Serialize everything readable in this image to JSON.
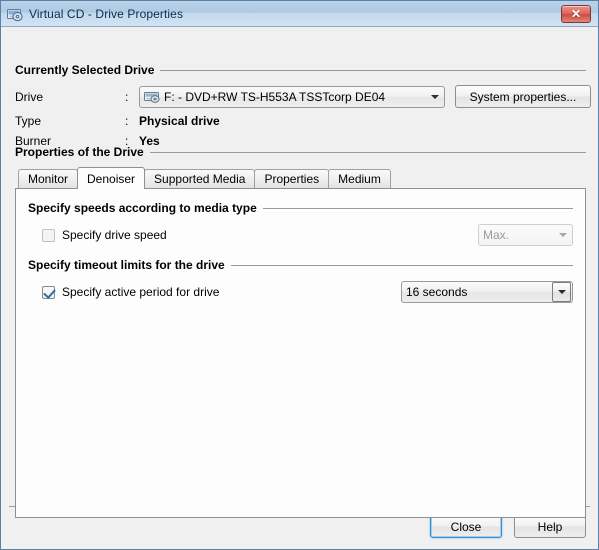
{
  "window": {
    "title": "Virtual CD - Drive Properties",
    "icon": "cd-drive-icon",
    "close_label": "✕"
  },
  "selected_drive": {
    "group_title": "Currently Selected Drive",
    "labels": {
      "drive": "Drive",
      "type": "Type",
      "burner": "Burner",
      "colon": ":"
    },
    "drive_combo": {
      "value": "F: - DVD+RW TS-H553A TSSTcorp DE04",
      "icon": "optical-drive-icon"
    },
    "type_value": "Physical drive",
    "burner_value": "Yes",
    "system_properties_label": "System properties..."
  },
  "properties": {
    "group_title": "Properties of the Drive",
    "tabs": [
      {
        "label": "Monitor",
        "selected": false
      },
      {
        "label": "Denoiser",
        "selected": true
      },
      {
        "label": "Supported Media",
        "selected": false
      },
      {
        "label": "Properties",
        "selected": false
      },
      {
        "label": "Medium",
        "selected": false
      }
    ],
    "speeds_group": {
      "title": "Specify speeds according to media type",
      "checkbox_label": "Specify drive speed",
      "checked": false,
      "enabled": false,
      "speed_value": "Max."
    },
    "timeout_group": {
      "title": "Specify timeout limits for the drive",
      "checkbox_label": "Specify active period for drive",
      "checked": true,
      "enabled": true,
      "timeout_value": "16 seconds"
    }
  },
  "footer": {
    "close_label": "Close",
    "help_label": "Help"
  },
  "colors": {
    "titlebar_start": "#b9d2e8",
    "titlebar_end": "#d3e3f2",
    "dialog_bg": "#f0f0f0",
    "panel_bg": "#fdfdfd",
    "close_button_red": "#cc4b3e",
    "default_button_focus": "#3c8ccd",
    "checkmark": "#2a6fb0"
  }
}
